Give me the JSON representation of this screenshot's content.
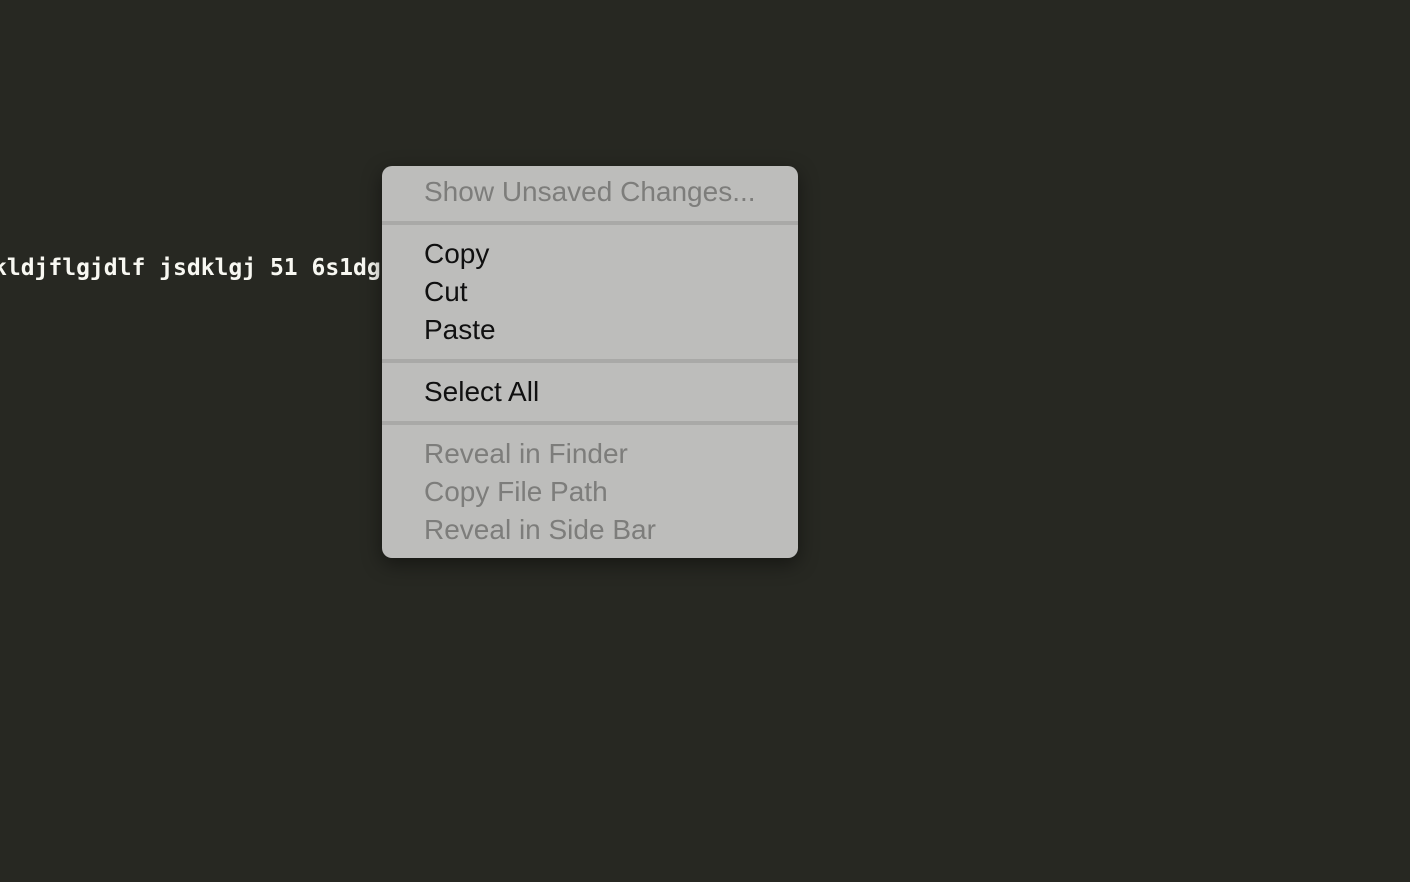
{
  "editor": {
    "code_line": "kldjflgjdlf jsdklgj 51 6s1dg"
  },
  "context_menu": {
    "show_unsaved_changes": "Show Unsaved Changes...",
    "copy": "Copy",
    "cut": "Cut",
    "paste": "Paste",
    "select_all": "Select All",
    "reveal_in_finder": "Reveal in Finder",
    "copy_file_path": "Copy File Path",
    "reveal_in_side_bar": "Reveal in Side Bar"
  },
  "colors": {
    "editor_background": "#272822",
    "editor_text": "#f8f8f2",
    "menu_background": "#bdbdbb",
    "menu_text_enabled": "#101010",
    "menu_text_disabled": "#7d7d7b"
  }
}
